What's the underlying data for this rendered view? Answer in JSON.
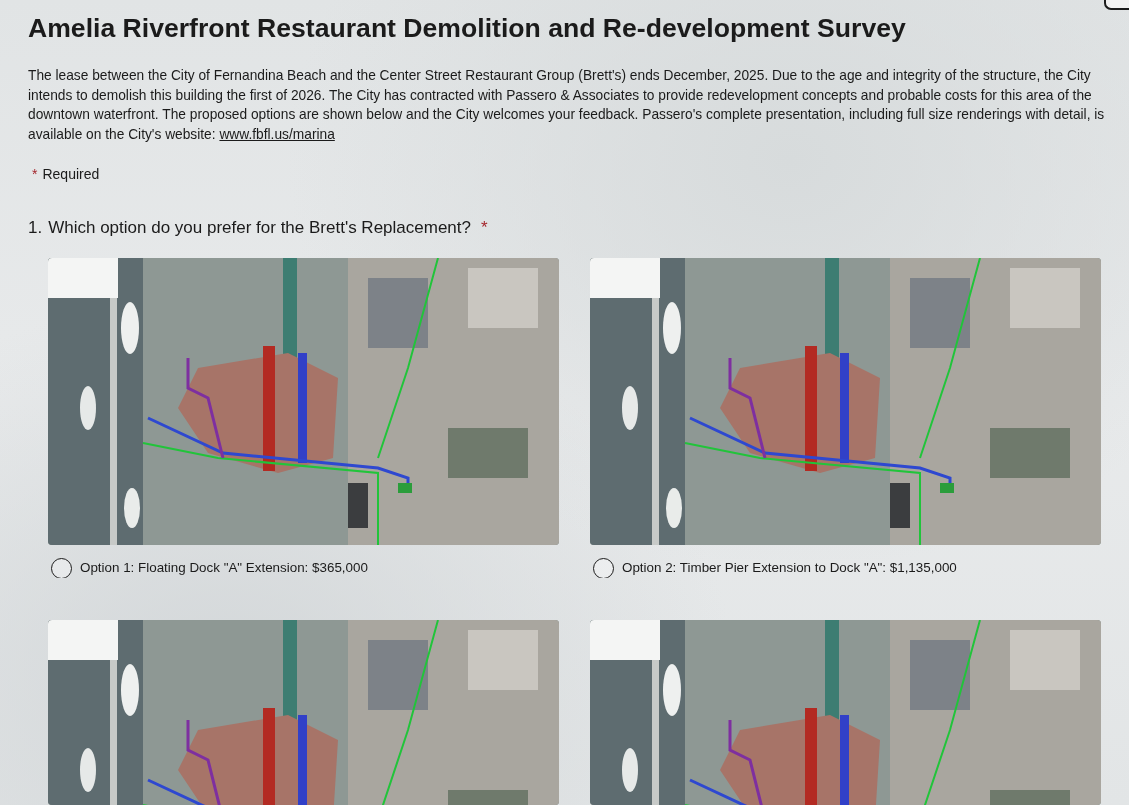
{
  "survey": {
    "title": "Amelia Riverfront Restaurant Demolition and Re-development Survey",
    "description": "The lease between the City of Fernandina Beach and the Center Street Restaurant Group (Brett's) ends December, 2025. Due to the age and integrity of the structure, the City intends to demolish this building the first of 2026. The City has contracted with Passero & Associates to provide redevelopment concepts and probable costs for this area of the downtown waterfront. The proposed options are shown below and the City welcomes your feedback. Passero's complete presentation, including full size renderings with detail, is available on the City's website:",
    "description_link": "www.fbfl.us/marina",
    "required_note": {
      "mark": "*",
      "text": "Required"
    }
  },
  "questions": [
    {
      "number": "1.",
      "text": "Which option do you prefer for the Brett's Replacement?",
      "required_mark": "*",
      "options": [
        {
          "image": true,
          "label": "Option 1: Floating Dock \"A\" Extension: $365,000",
          "selected": false
        },
        {
          "image": true,
          "label": "Option 2: Timber Pier Extension to Dock \"A\": $1,135,000",
          "selected": false
        },
        {
          "image": true
        },
        {
          "image": true
        }
      ]
    }
  ]
}
